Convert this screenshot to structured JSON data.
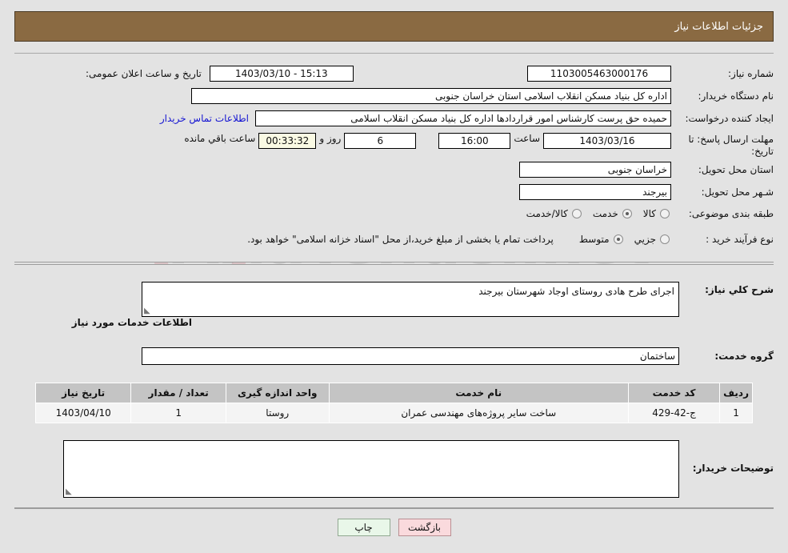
{
  "header": {
    "title": "جزئیات اطلاعات نیاز"
  },
  "top_section": {
    "need_number": {
      "label": "شماره نیاز:",
      "value": "1103005463000176"
    },
    "announce_datetime": {
      "label": "تاریخ و ساعت اعلان عمومی:",
      "value": "1403/03/10 - 15:13"
    },
    "buyer_org": {
      "label": "نام دستگاه خریدار:",
      "value": "اداره کل بنیاد مسکن انقلاب اسلامی استان خراسان جنوبی"
    },
    "request_creator": {
      "label": "ایجاد کننده درخواست:",
      "value": "حمیده حق پرست کارشناس امور قراردادها اداره کل بنیاد مسکن انقلاب اسلامی",
      "contact_link": "اطلاعات تماس خریدار"
    },
    "deadline": {
      "label": "مهلت ارسال پاسخ: تا تاریخ:",
      "date": "1403/03/16",
      "time_label": "ساعت",
      "time": "16:00",
      "days_value": "6",
      "days_label": "روز و",
      "countdown": "00:33:32",
      "remaining_label": "ساعت باقي مانده"
    },
    "delivery_province": {
      "label": "استان محل تحویل:",
      "value": "خراسان جنوبی"
    },
    "delivery_city": {
      "label": "شـهر محل تحویل:",
      "value": "بیرجند"
    },
    "subject_category": {
      "label": "طبقه بندی موضوعی:",
      "options": [
        {
          "label": "کالا",
          "selected": false
        },
        {
          "label": "خدمت",
          "selected": true
        },
        {
          "label": "کالا/خدمت",
          "selected": false
        }
      ]
    },
    "purchase_type": {
      "label": "نوع فرآیند خرید :",
      "options": [
        {
          "label": "جزیي",
          "selected": false
        },
        {
          "label": "متوسط",
          "selected": true
        }
      ],
      "note": "پرداخت تمام یا بخشی از مبلغ خرید،از محل \"اسناد خزانه اسلامی\" خواهد بود."
    }
  },
  "detail_section": {
    "general_description": {
      "label": "شرح کلي نیاز:",
      "value": "اجرای طرح هادی روستای اوجاد شهرستان بیرجند"
    },
    "services_info_title": "اطلاعات خدمات مورد نیاز",
    "service_group": {
      "label": "گروه خدمت:",
      "value": "ساختمان"
    },
    "table": {
      "columns": [
        "ردیف",
        "کد خدمت",
        "نام خدمت",
        "واحد اندازه گیری",
        "تعداد / مقدار",
        "تاریخ نیاز"
      ],
      "rows": [
        {
          "row": "1",
          "code": "ج-42-429",
          "name": "ساخت سایر پروژه‌های مهندسی عمران",
          "unit": "روستا",
          "quantity": "1",
          "need_date": "1403/04/10"
        }
      ]
    },
    "buyer_notes": {
      "label": "توضیحات خریدار:",
      "value": ""
    }
  },
  "footer": {
    "back_button": "بازگشت",
    "print_button": "چاپ"
  },
  "watermark": {
    "text": "AriaTender.net"
  },
  "colors": {
    "header_bg": "#8a6a42",
    "page_bg": "#e3e3e3",
    "link": "#1414d2",
    "timer_bg": "#fafae4",
    "back_btn": "#fadadd",
    "print_btn": "#e9f7e9",
    "table_header": "#c4c4c4"
  }
}
